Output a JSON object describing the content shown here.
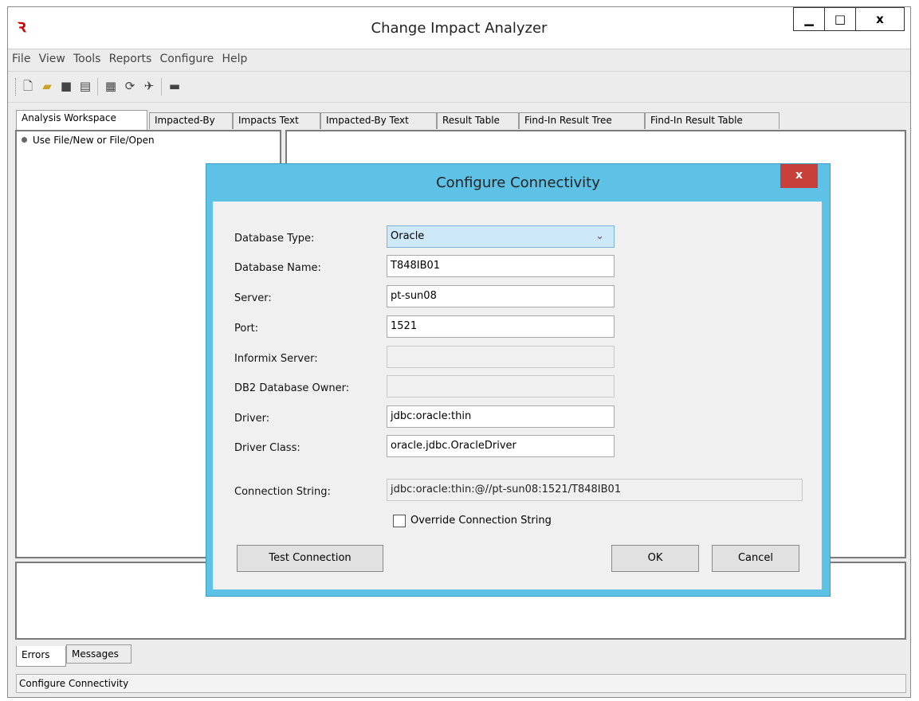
{
  "window": {
    "title": "Change Impact Analyzer",
    "controls": [
      "minimize-icon",
      "maximize-icon",
      "close-icon"
    ]
  },
  "menu": [
    "File",
    "View",
    "Tools",
    "Reports",
    "Configure",
    "Help"
  ],
  "toolbar": [
    "new-icon",
    "open-icon",
    "save-icon",
    "save-all-icon",
    "grid-icon",
    "refresh-icon",
    "satellite-icon",
    "report-icon"
  ],
  "tabs": [
    "Analysis Workspace",
    "Impacted-By",
    "Impacts Text",
    "Impacted-By Text",
    "Result Table",
    "Find-In Result Tree",
    "Find-In Result Table"
  ],
  "tree": {
    "item": "Use File/New or File/Open"
  },
  "bottom_tabs": [
    "Errors",
    "Messages"
  ],
  "status": "Configure Connectivity",
  "dialog": {
    "title": "Configure Connectivity",
    "close": "x",
    "labels": {
      "database_type": "Database Type:",
      "database_name": "Database Name:",
      "server": "Server:",
      "port": "Port:",
      "informix_server": "Informix Server:",
      "db2_owner": "DB2 Database Owner:",
      "driver": "Driver:",
      "driver_class": "Driver Class:",
      "connection_string": "Connection String:"
    },
    "values": {
      "database_type": "Oracle",
      "database_name": "T848IB01",
      "server": "pt-sun08",
      "port": "1521",
      "informix_server": "",
      "db2_owner": "",
      "driver": "jdbc:oracle:thin",
      "driver_class": "oracle.jdbc.OracleDriver",
      "connection_string": "jdbc:oracle:thin:@//pt-sun08:1521/T848IB01"
    },
    "override_label": "Override Connection String",
    "override_checked": false,
    "buttons": {
      "test": "Test Connection",
      "ok": "OK",
      "cancel": "Cancel"
    }
  }
}
